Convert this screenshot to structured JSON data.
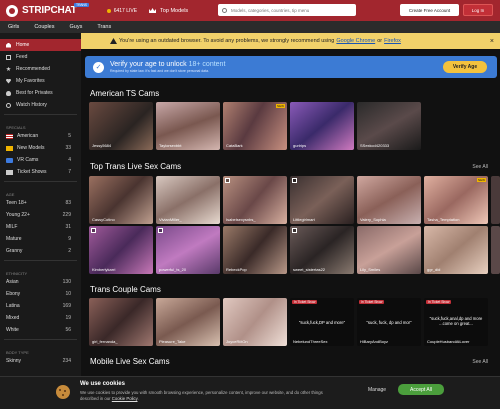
{
  "header": {
    "logo_text": "STRIPCHAT",
    "logo_tag": "TRANS",
    "live_count": "6417",
    "live_label": "LIVE",
    "top_models": "Top Models",
    "search_placeholder": "Models, categories, countries, tip menu",
    "create_account": "Create Free Account",
    "login": "Log In"
  },
  "catbar": [
    "Girls",
    "Couples",
    "Guys",
    "Trans"
  ],
  "sidebar": {
    "main": [
      {
        "label": "Home",
        "icon": "home-icon",
        "active": true
      },
      {
        "label": "Feed",
        "icon": "feed-icon"
      },
      {
        "label": "Recommended",
        "icon": "star-icon"
      },
      {
        "label": "My Favorites",
        "icon": "heart-icon"
      },
      {
        "label": "Best for Privates",
        "icon": "fire-icon"
      },
      {
        "label": "Watch History",
        "icon": "history-icon"
      }
    ],
    "specials_heading": "SPECIALS",
    "specials": [
      {
        "label": "American",
        "count": "5"
      },
      {
        "label": "New Models",
        "count": "33"
      },
      {
        "label": "VR Cams",
        "count": "4"
      },
      {
        "label": "Ticket Shows",
        "count": "7"
      }
    ],
    "age_heading": "AGE",
    "age": [
      {
        "label": "Teen 18+",
        "count": "83"
      },
      {
        "label": "Young 22+",
        "count": "229"
      },
      {
        "label": "MILF",
        "count": "31"
      },
      {
        "label": "Mature",
        "count": "9"
      },
      {
        "label": "Granny",
        "count": "2"
      }
    ],
    "ethnicity_heading": "ETHNICITY",
    "ethnicity": [
      {
        "label": "Asian",
        "count": "130"
      },
      {
        "label": "Ebony",
        "count": "10"
      },
      {
        "label": "Latina",
        "count": "169"
      },
      {
        "label": "Mixed",
        "count": "19"
      },
      {
        "label": "White",
        "count": "56"
      }
    ],
    "body_heading": "BODY TYPE",
    "body": [
      {
        "label": "Skinny",
        "count": "234"
      }
    ]
  },
  "warning": {
    "text_before": "You're using an outdated browser. To avoid any problems, we strongly recommend using",
    "link1": "Google Chrome",
    "or": "or",
    "link2": "Firefox"
  },
  "verify": {
    "title": "Verify your age to unlock",
    "title_highlight": "18+ content",
    "subtitle": "Required by state law. It's fast and we don't store personal data.",
    "button": "Verify Age"
  },
  "sections": {
    "american": {
      "title": "American TS Cams"
    },
    "top": {
      "title": "Top Trans Live Sex Cams",
      "see_all": "See All"
    },
    "couple": {
      "title": "Trans Couple Cams"
    },
    "mobile": {
      "title": "Mobile Live Sex Cams",
      "see_all": "See All"
    }
  },
  "american_cams": [
    "Jessy5684",
    "Taylorsexbbt",
    "CataBark",
    "gurlrips",
    "SSexkcd420333"
  ],
  "top_row1": [
    "CassyCotino",
    "VivianMiller_",
    "Isabelsexysnbs_",
    "Littlegirlmart",
    "Valery_Sophia",
    "Tasha_Temptation"
  ],
  "top_row2": [
    "Kimberlykarri",
    "powerful_ts_20",
    "RebeckPop",
    "sweet_sistertas22",
    "Lily_Smiles",
    "ggr_did"
  ],
  "couple_cams": [
    "girl_fernanda_",
    "Pleasure_Take",
    "JoyceRiitOn",
    "NebelundThreeSex",
    "HiBaryAndBoyz",
    "CoupleHusbandAtLover"
  ],
  "couple_texts": [
    "",
    "",
    "",
    "\"suck,fuck,DP and more\"",
    "\"suck, fuck, dp and mor\"",
    "\"suck,fuck,anal,dp and more ...come on great..."
  ],
  "ticket_show": "In Ticket Show",
  "new_tag": "NEW",
  "cookie": {
    "title": "We use cookies",
    "text": "We use cookies to provide you with smooth browsing experience, personalize content, improve our website, and do other things described in our",
    "link": "Cookie Policy",
    "manage": "Manage",
    "accept": "Accept All"
  }
}
